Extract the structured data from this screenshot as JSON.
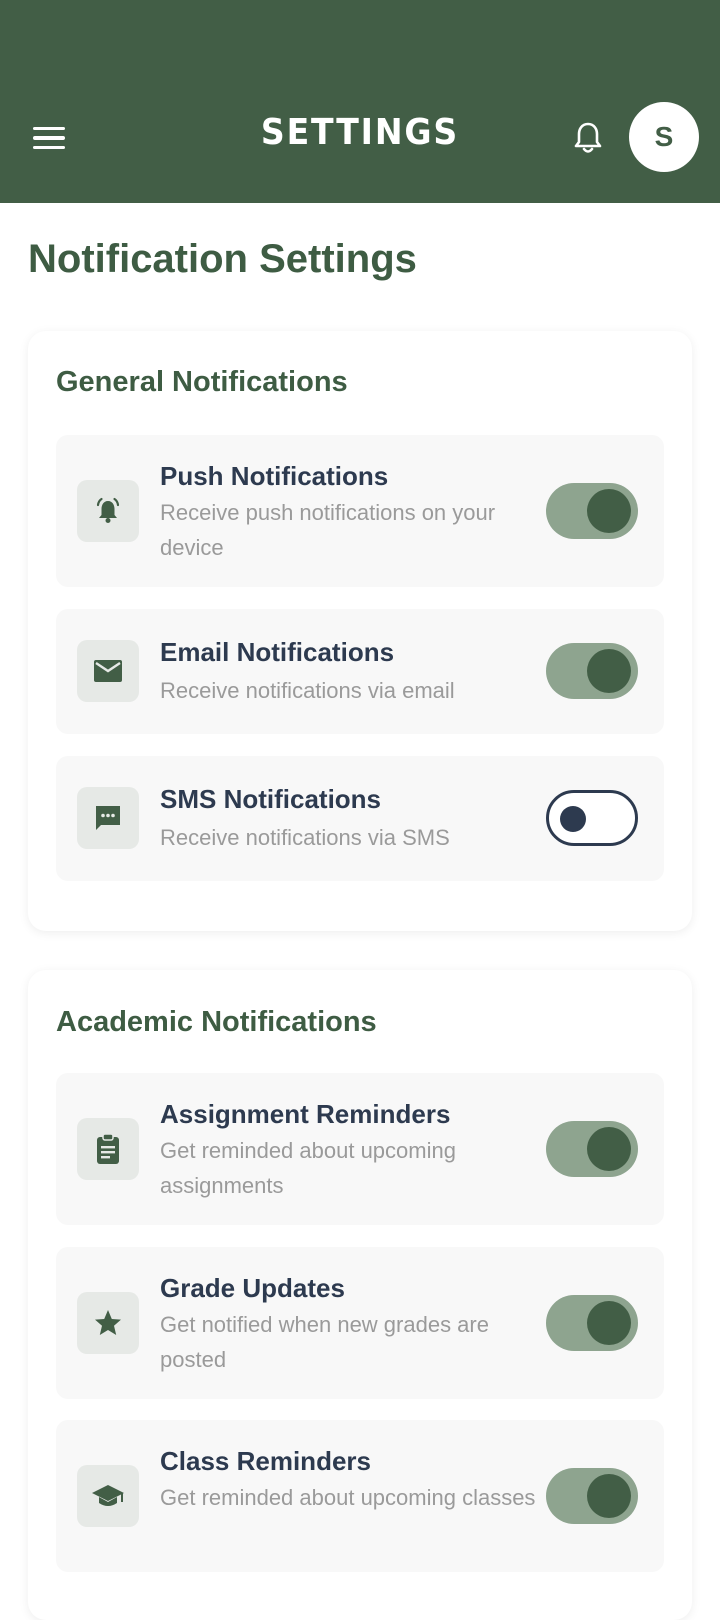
{
  "header": {
    "title": "SETTINGS",
    "avatar_initial": "S",
    "background_color": "#425e46"
  },
  "page": {
    "title": "Notification Settings"
  },
  "sections": [
    {
      "title": "General Notifications",
      "items": [
        {
          "title": "Push Notifications",
          "subtitle": "Receive push notifications on your device",
          "icon": "bell-ringing-icon",
          "enabled": true
        },
        {
          "title": "Email Notifications",
          "subtitle": "Receive notifications via email",
          "icon": "email-icon",
          "enabled": true
        },
        {
          "title": "SMS Notifications",
          "subtitle": "Receive notifications via SMS",
          "icon": "sms-chat-icon",
          "enabled": false
        }
      ]
    },
    {
      "title": "Academic Notifications",
      "items": [
        {
          "title": "Assignment Reminders",
          "subtitle": "Get reminded about upcoming assignments",
          "icon": "assignment-clipboard-icon",
          "enabled": true
        },
        {
          "title": "Grade Updates",
          "subtitle": "Get notified when new grades are posted",
          "icon": "star-icon",
          "enabled": true
        },
        {
          "title": "Class Reminders",
          "subtitle": "Get reminded about upcoming classes",
          "icon": "graduation-cap-icon",
          "enabled": true
        }
      ]
    }
  ],
  "colors": {
    "accent": "#425e46",
    "toggle_on_track": "#8ea48f",
    "title_text": "#2d3a4f",
    "subtitle_text": "#9a9a9a"
  }
}
